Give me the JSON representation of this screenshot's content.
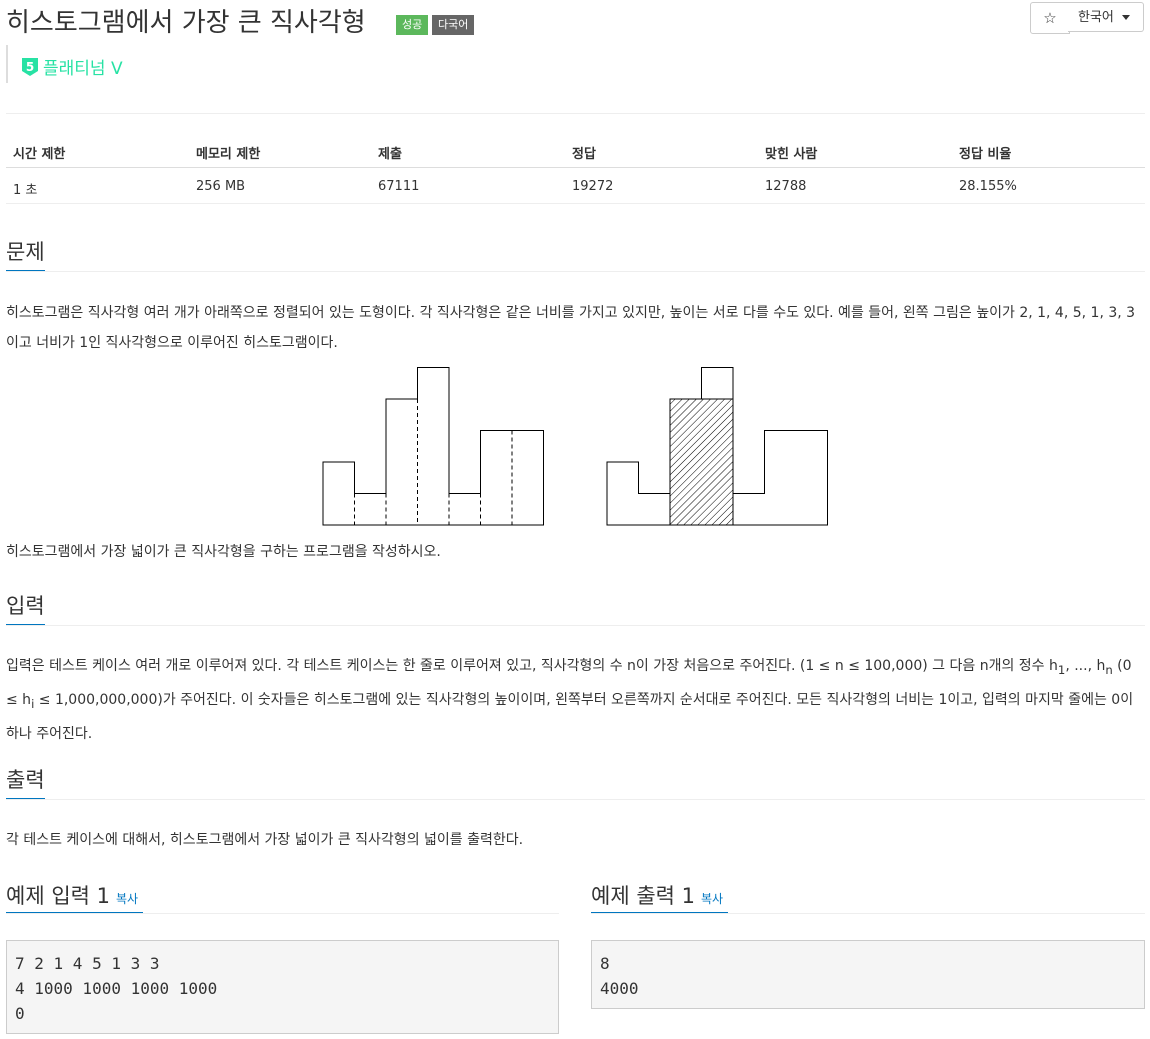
{
  "header": {
    "title": "히스토그램에서 가장 큰 직사각형",
    "badge_success": "성공",
    "badge_multilang": "다국어",
    "star_label": "☆",
    "language": "한국어",
    "tier_number": "5",
    "tier_label": "플래티넘 V",
    "tier_color": "#27e2a4"
  },
  "info_table": {
    "headers": [
      "시간 제한",
      "메모리 제한",
      "제출",
      "정답",
      "맞힌 사람",
      "정답 비율"
    ],
    "values": [
      "1 초",
      "256 MB",
      "67111",
      "19272",
      "12788",
      "28.155%"
    ]
  },
  "problem": {
    "title": "문제",
    "text1": "히스토그램은 직사각형 여러 개가 아래쪽으로 정렬되어 있는 도형이다. 각 직사각형은 같은 너비를 가지고 있지만, 높이는 서로 다를 수도 있다. 예를 들어, 왼쪽 그림은 높이가 2, 1, 4, 5, 1, 3, 3이고 너비가 1인 직사각형으로 이루어진 히스토그램이다.",
    "text2": "히스토그램에서 가장 넓이가 큰 직사각형을 구하는 프로그램을 작성하시오."
  },
  "figure": {
    "heights": [
      2,
      1,
      4,
      5,
      1,
      3,
      3
    ],
    "largest_rect": {
      "start_index": 2,
      "end_index": 3,
      "height": 4
    }
  },
  "input": {
    "title": "입력",
    "text_a": "입력은 테스트 케이스 여러 개로 이루어져 있다. 각 테스트 케이스는 한 줄로 이루어져 있고, 직사각형의 수 n이 가장 처음으로 주어진다. (1 ≤ n ≤ 100,000) 그 다음 n개의 정수 h",
    "sub_1": "1",
    "text_b": ", ..., h",
    "sub_n": "n",
    "text_c": " (0 ≤ h",
    "sub_i": "i",
    "text_d": " ≤ 1,000,000,000)가 주어진다. 이 숫자들은 히스토그램에 있는 직사각형의 높이이며, 왼쪽부터 오른쪽까지 순서대로 주어진다. 모든 직사각형의 너비는 1이고, 입력의 마지막 줄에는 0이 하나 주어진다."
  },
  "output": {
    "title": "출력",
    "text": "각 테스트 케이스에 대해서, 히스토그램에서 가장 넓이가 큰 직사각형의 넓이를 출력한다."
  },
  "sample_input": {
    "title": "예제 입력 1",
    "copy_label": "복사",
    "content": "7 2 1 4 5 1 3 3\n4 1000 1000 1000 1000\n0"
  },
  "sample_output": {
    "title": "예제 출력 1",
    "copy_label": "복사",
    "content": "8\n4000"
  }
}
